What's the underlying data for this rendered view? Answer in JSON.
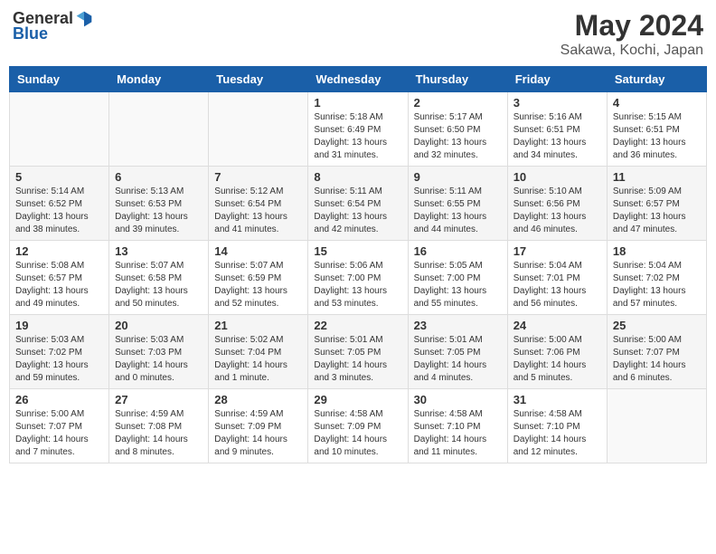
{
  "header": {
    "logo_general": "General",
    "logo_blue": "Blue",
    "month_year": "May 2024",
    "location": "Sakawa, Kochi, Japan"
  },
  "weekdays": [
    "Sunday",
    "Monday",
    "Tuesday",
    "Wednesday",
    "Thursday",
    "Friday",
    "Saturday"
  ],
  "weeks": [
    [
      {
        "day": "",
        "info": ""
      },
      {
        "day": "",
        "info": ""
      },
      {
        "day": "",
        "info": ""
      },
      {
        "day": "1",
        "info": "Sunrise: 5:18 AM\nSunset: 6:49 PM\nDaylight: 13 hours\nand 31 minutes."
      },
      {
        "day": "2",
        "info": "Sunrise: 5:17 AM\nSunset: 6:50 PM\nDaylight: 13 hours\nand 32 minutes."
      },
      {
        "day": "3",
        "info": "Sunrise: 5:16 AM\nSunset: 6:51 PM\nDaylight: 13 hours\nand 34 minutes."
      },
      {
        "day": "4",
        "info": "Sunrise: 5:15 AM\nSunset: 6:51 PM\nDaylight: 13 hours\nand 36 minutes."
      }
    ],
    [
      {
        "day": "5",
        "info": "Sunrise: 5:14 AM\nSunset: 6:52 PM\nDaylight: 13 hours\nand 38 minutes."
      },
      {
        "day": "6",
        "info": "Sunrise: 5:13 AM\nSunset: 6:53 PM\nDaylight: 13 hours\nand 39 minutes."
      },
      {
        "day": "7",
        "info": "Sunrise: 5:12 AM\nSunset: 6:54 PM\nDaylight: 13 hours\nand 41 minutes."
      },
      {
        "day": "8",
        "info": "Sunrise: 5:11 AM\nSunset: 6:54 PM\nDaylight: 13 hours\nand 42 minutes."
      },
      {
        "day": "9",
        "info": "Sunrise: 5:11 AM\nSunset: 6:55 PM\nDaylight: 13 hours\nand 44 minutes."
      },
      {
        "day": "10",
        "info": "Sunrise: 5:10 AM\nSunset: 6:56 PM\nDaylight: 13 hours\nand 46 minutes."
      },
      {
        "day": "11",
        "info": "Sunrise: 5:09 AM\nSunset: 6:57 PM\nDaylight: 13 hours\nand 47 minutes."
      }
    ],
    [
      {
        "day": "12",
        "info": "Sunrise: 5:08 AM\nSunset: 6:57 PM\nDaylight: 13 hours\nand 49 minutes."
      },
      {
        "day": "13",
        "info": "Sunrise: 5:07 AM\nSunset: 6:58 PM\nDaylight: 13 hours\nand 50 minutes."
      },
      {
        "day": "14",
        "info": "Sunrise: 5:07 AM\nSunset: 6:59 PM\nDaylight: 13 hours\nand 52 minutes."
      },
      {
        "day": "15",
        "info": "Sunrise: 5:06 AM\nSunset: 7:00 PM\nDaylight: 13 hours\nand 53 minutes."
      },
      {
        "day": "16",
        "info": "Sunrise: 5:05 AM\nSunset: 7:00 PM\nDaylight: 13 hours\nand 55 minutes."
      },
      {
        "day": "17",
        "info": "Sunrise: 5:04 AM\nSunset: 7:01 PM\nDaylight: 13 hours\nand 56 minutes."
      },
      {
        "day": "18",
        "info": "Sunrise: 5:04 AM\nSunset: 7:02 PM\nDaylight: 13 hours\nand 57 minutes."
      }
    ],
    [
      {
        "day": "19",
        "info": "Sunrise: 5:03 AM\nSunset: 7:02 PM\nDaylight: 13 hours\nand 59 minutes."
      },
      {
        "day": "20",
        "info": "Sunrise: 5:03 AM\nSunset: 7:03 PM\nDaylight: 14 hours\nand 0 minutes."
      },
      {
        "day": "21",
        "info": "Sunrise: 5:02 AM\nSunset: 7:04 PM\nDaylight: 14 hours\nand 1 minute."
      },
      {
        "day": "22",
        "info": "Sunrise: 5:01 AM\nSunset: 7:05 PM\nDaylight: 14 hours\nand 3 minutes."
      },
      {
        "day": "23",
        "info": "Sunrise: 5:01 AM\nSunset: 7:05 PM\nDaylight: 14 hours\nand 4 minutes."
      },
      {
        "day": "24",
        "info": "Sunrise: 5:00 AM\nSunset: 7:06 PM\nDaylight: 14 hours\nand 5 minutes."
      },
      {
        "day": "25",
        "info": "Sunrise: 5:00 AM\nSunset: 7:07 PM\nDaylight: 14 hours\nand 6 minutes."
      }
    ],
    [
      {
        "day": "26",
        "info": "Sunrise: 5:00 AM\nSunset: 7:07 PM\nDaylight: 14 hours\nand 7 minutes."
      },
      {
        "day": "27",
        "info": "Sunrise: 4:59 AM\nSunset: 7:08 PM\nDaylight: 14 hours\nand 8 minutes."
      },
      {
        "day": "28",
        "info": "Sunrise: 4:59 AM\nSunset: 7:09 PM\nDaylight: 14 hours\nand 9 minutes."
      },
      {
        "day": "29",
        "info": "Sunrise: 4:58 AM\nSunset: 7:09 PM\nDaylight: 14 hours\nand 10 minutes."
      },
      {
        "day": "30",
        "info": "Sunrise: 4:58 AM\nSunset: 7:10 PM\nDaylight: 14 hours\nand 11 minutes."
      },
      {
        "day": "31",
        "info": "Sunrise: 4:58 AM\nSunset: 7:10 PM\nDaylight: 14 hours\nand 12 minutes."
      },
      {
        "day": "",
        "info": ""
      }
    ]
  ]
}
